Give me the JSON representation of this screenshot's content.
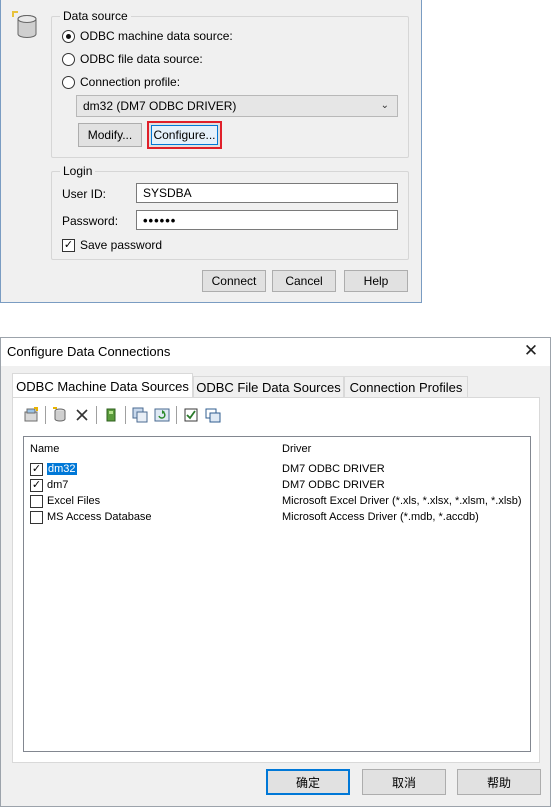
{
  "top_dialog": {
    "data_source": {
      "legend": "Data source",
      "opt_machine": "ODBC machine data source:",
      "opt_file": "ODBC file data source:",
      "opt_profile": "Connection profile:",
      "selected_source": "dm32 (DM7 ODBC DRIVER)",
      "modify_label": "Modify...",
      "configure_label": "Configure..."
    },
    "login": {
      "legend": "Login",
      "user_label": "User ID:",
      "user_value": "SYSDBA",
      "password_label": "Password:",
      "password_value": "••••••",
      "save_password_label": "Save password",
      "save_password_checked": "✓"
    },
    "buttons": {
      "connect": "Connect",
      "cancel": "Cancel",
      "help": "Help"
    }
  },
  "bottom_dialog": {
    "title": "Configure Data Connections",
    "close_glyph": "✕",
    "tabs": [
      {
        "label": "ODBC Machine Data Sources"
      },
      {
        "label": "ODBC File Data Sources"
      },
      {
        "label": "Connection Profiles"
      }
    ],
    "toolbar_icons": [
      "new-icon",
      "database-icon",
      "delete-icon",
      "driver-icon",
      "copy-icon",
      "refresh-icon",
      "check-all-icon",
      "windows-icon"
    ],
    "list": {
      "headers": {
        "name": "Name",
        "driver": "Driver"
      },
      "rows": [
        {
          "checked": "✓",
          "name": "dm32",
          "driver": "DM7 ODBC DRIVER"
        },
        {
          "checked": "✓",
          "name": "dm7",
          "driver": "DM7 ODBC DRIVER"
        },
        {
          "checked": "",
          "name": "Excel Files",
          "driver": "Microsoft Excel Driver (*.xls, *.xlsx, *.xlsm, *.xlsb)"
        },
        {
          "checked": "",
          "name": "MS Access Database",
          "driver": "Microsoft Access Driver (*.mdb, *.accdb)"
        }
      ]
    },
    "buttons": {
      "ok": "确定",
      "cancel": "取消",
      "help": "帮助"
    }
  },
  "colors": {
    "highlight_red": "#e0202a",
    "selection_blue": "#0078d7",
    "dialog_bg": "#f0f0f0"
  }
}
